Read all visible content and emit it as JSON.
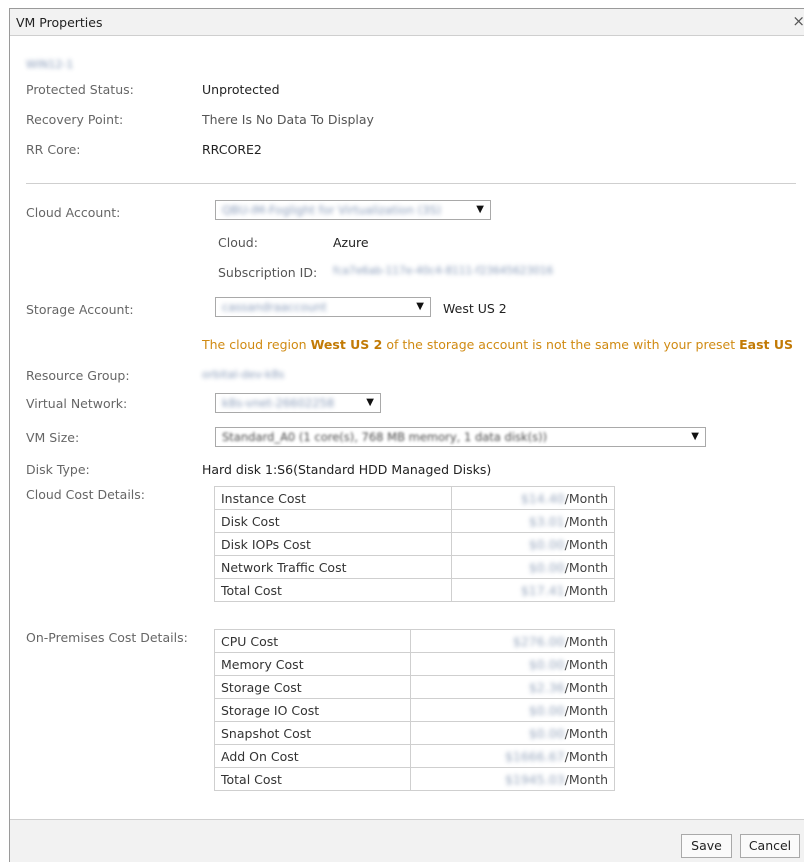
{
  "dialog": {
    "title": "VM Properties",
    "close_glyph": "×"
  },
  "vm": {
    "name_redacted": "WIN12-1"
  },
  "summary": {
    "protected_status_label": "Protected Status:",
    "protected_status_value": "Unprotected",
    "recovery_point_label": "Recovery Point:",
    "recovery_point_value": "There Is No Data To Display",
    "rr_core_label": "RR Core:",
    "rr_core_value": "RRCORE2"
  },
  "cloud": {
    "account_label": "Cloud Account:",
    "account_value": "QBU-IM-Foglight for Virtualization (3S)",
    "cloud_label": "Cloud:",
    "cloud_value": "Azure",
    "subscription_label": "Subscription ID:",
    "subscription_value": "fca7e6ab-117e-40c4-8111-f23645623016",
    "storage_label": "Storage Account:",
    "storage_value": "cassandraaccount",
    "storage_region": "West US 2",
    "warning_prefix": "The cloud region ",
    "warning_region": "West US 2",
    "warning_middle": " of the storage account is not the same with your preset ",
    "warning_preset": "East US",
    "resource_group_label": "Resource Group:",
    "resource_group_value": "orbital-dev-k8s",
    "vnet_label": "Virtual Network:",
    "vnet_value": "k8s-vnet-26602258",
    "vm_size_label": "VM Size:",
    "vm_size_value": "Standard_A0 (1 core(s), 768 MB memory, 1 data disk(s))",
    "disk_type_label": "Disk Type:",
    "disk_type_value": "Hard disk 1:S6(Standard HDD Managed Disks)"
  },
  "cloud_costs": {
    "label": "Cloud Cost Details:",
    "rows": [
      {
        "name": "Instance Cost",
        "amount": "$14.40",
        "unit": "/Month"
      },
      {
        "name": "Disk Cost",
        "amount": "$3.01",
        "unit": "/Month"
      },
      {
        "name": "Disk IOPs Cost",
        "amount": "$0.00",
        "unit": "/Month"
      },
      {
        "name": "Network Traffic Cost",
        "amount": "$0.00",
        "unit": "/Month"
      },
      {
        "name": "Total Cost",
        "amount": "$17.41",
        "unit": "/Month"
      }
    ]
  },
  "onprem_costs": {
    "label": "On-Premises Cost Details:",
    "rows": [
      {
        "name": "CPU Cost",
        "amount": "$276.00",
        "unit": "/Month"
      },
      {
        "name": "Memory Cost",
        "amount": "$0.00",
        "unit": "/Month"
      },
      {
        "name": "Storage Cost",
        "amount": "$2.36",
        "unit": "/Month"
      },
      {
        "name": "Storage IO Cost",
        "amount": "$0.00",
        "unit": "/Month"
      },
      {
        "name": "Snapshot Cost",
        "amount": "$0.00",
        "unit": "/Month"
      },
      {
        "name": "Add On Cost",
        "amount": "$1666.67",
        "unit": "/Month"
      },
      {
        "name": "Total Cost",
        "amount": "$1945.03",
        "unit": "/Month"
      }
    ]
  },
  "footer": {
    "save_label": "Save",
    "cancel_label": "Cancel"
  },
  "icons": {
    "dropdown": "chevron-down-icon",
    "close": "close-icon"
  }
}
